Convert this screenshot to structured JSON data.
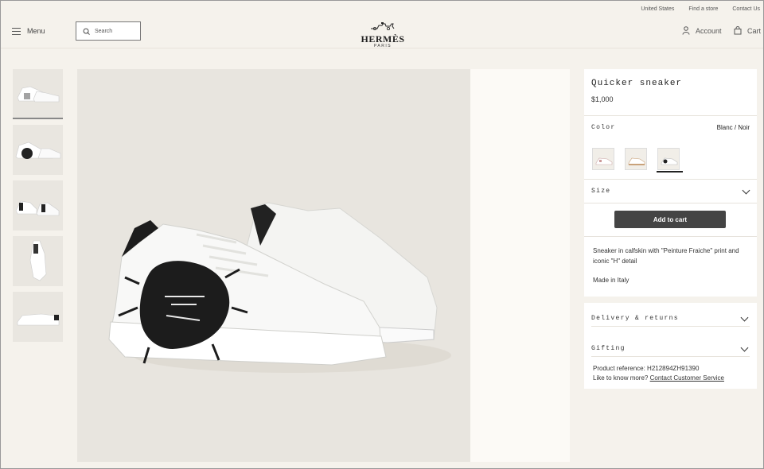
{
  "utility": {
    "country": "United States",
    "find_store": "Find a store",
    "contact": "Contact Us"
  },
  "header": {
    "menu_label": "Menu",
    "search_placeholder": "Search",
    "logo_word": "HERMÈS",
    "logo_sub": "PARIS",
    "account_label": "Account",
    "cart_label": "Cart"
  },
  "product": {
    "name": "Quicker sneaker",
    "price": "$1,000",
    "color_label": "Color",
    "color_value": "Blanc / Noir",
    "size_label": "Size",
    "add_to_cart": "Add to cart",
    "description": "Sneaker in calfskin with \"Peinture Fraiche\" print and iconic \"H\" detail",
    "made_in": "Made in Italy"
  },
  "info": {
    "delivery_label": "Delivery & returns",
    "gifting_label": "Gifting",
    "ref_label": "Product reference:",
    "ref_value": "H212894ZH91390",
    "more_label": "Like to know more?",
    "contact_link": "Contact Customer Service"
  },
  "colors": {
    "bg": "#f5f2ec",
    "button": "#444444",
    "panel": "#ffffff"
  }
}
